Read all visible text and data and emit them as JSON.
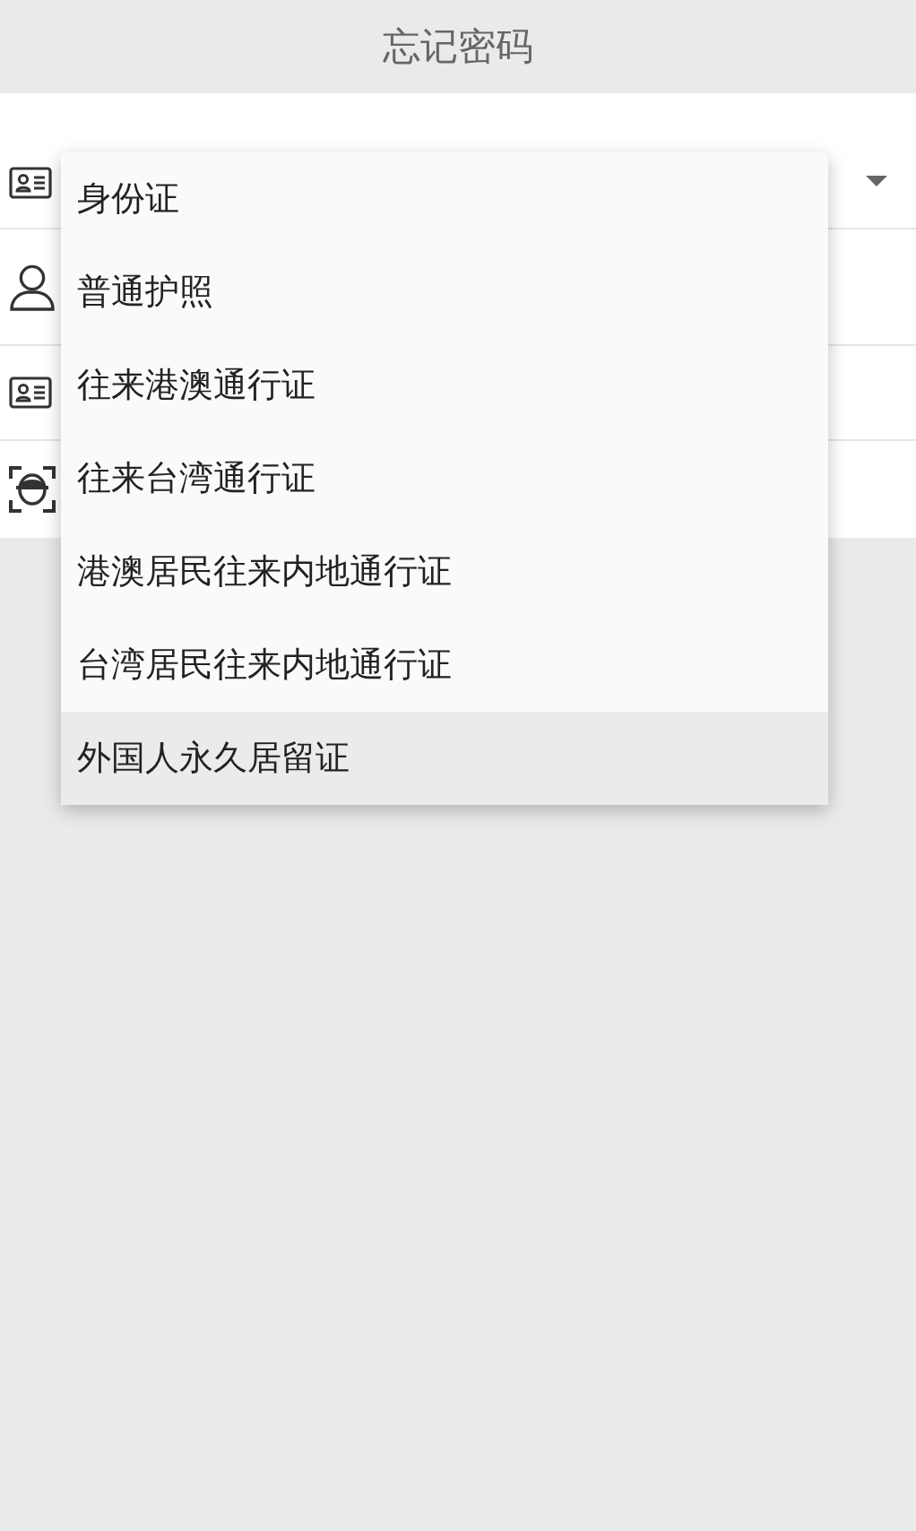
{
  "header": {
    "title": "忘记密码"
  },
  "menu": {
    "items": [
      {
        "label": "身份证",
        "selected": false
      },
      {
        "label": "普通护照",
        "selected": false
      },
      {
        "label": "往来港澳通行证",
        "selected": false
      },
      {
        "label": "往来台湾通行证",
        "selected": false
      },
      {
        "label": "港澳居民往来内地通行证",
        "selected": false
      },
      {
        "label": "台湾居民往来内地通行证",
        "selected": false
      },
      {
        "label": "外国人永久居留证",
        "selected": true
      }
    ]
  }
}
